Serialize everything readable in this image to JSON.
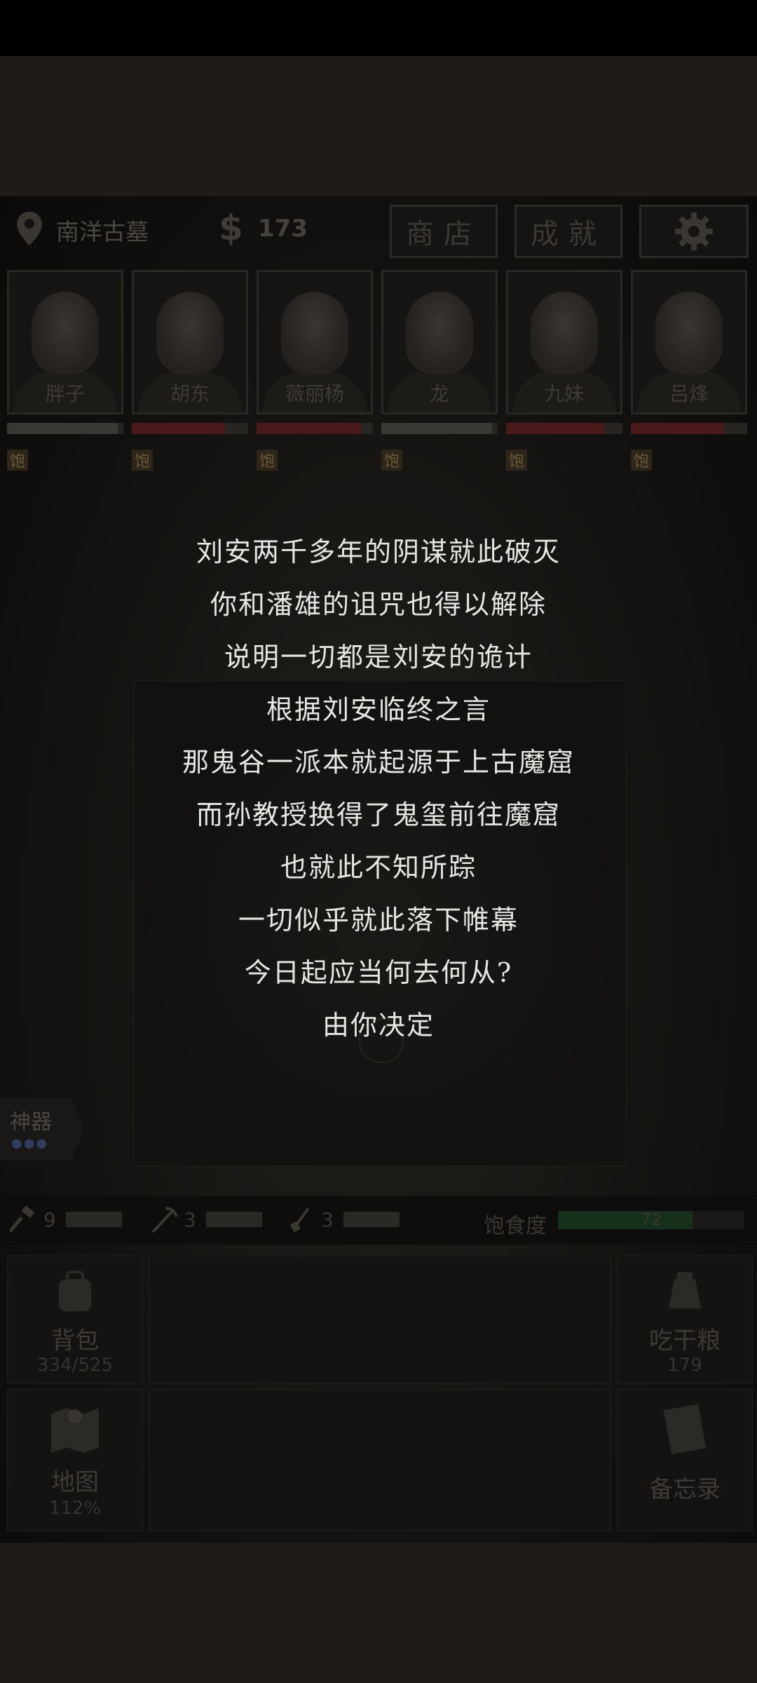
{
  "header": {
    "location": "南洋古墓",
    "money_symbol": "$",
    "money": "173",
    "shop_label": "商店",
    "achievement_label": "成就"
  },
  "characters": [
    {
      "name": "胖子",
      "hp": 0.95,
      "hp_color": "#3a3835",
      "status": "饱"
    },
    {
      "name": "胡东",
      "hp": 0.8,
      "hp_color": "#4a1a1a",
      "status": "饱"
    },
    {
      "name": "薇丽杨",
      "hp": 0.9,
      "hp_color": "#4a1a1a",
      "status": "饱"
    },
    {
      "name": "龙",
      "hp": 0.95,
      "hp_color": "#3a3835",
      "status": "饱"
    },
    {
      "name": "九妹",
      "hp": 0.85,
      "hp_color": "#4a1a1a",
      "status": "饱"
    },
    {
      "name": "吕烽",
      "hp": 0.8,
      "hp_color": "#4a1a1a",
      "status": "饱"
    }
  ],
  "story_lines": [
    "刘安两千多年的阴谋就此破灭",
    "你和潘雄的诅咒也得以解除",
    "说明一切都是刘安的诡计",
    "根据刘安临终之言",
    "那鬼谷一派本就起源于上古魔窟",
    "而孙教授换得了鬼玺前往魔窟",
    "也就此不知所踪",
    "一切似乎就此落下帷幕",
    "今日起应当何去何从?",
    "由你决定"
  ],
  "artifact": {
    "label": "神器",
    "dots": "●●●"
  },
  "tools": [
    {
      "icon": "hammer-icon",
      "count": "9"
    },
    {
      "icon": "pickaxe-icon",
      "count": "3"
    },
    {
      "icon": "shovel-icon",
      "count": "3"
    }
  ],
  "satiety": {
    "label": "饱食度",
    "value": "72",
    "fraction": 0.72
  },
  "tiles": {
    "backpack": {
      "label": "背包",
      "sub": "334/525"
    },
    "eat": {
      "label": "吃干粮",
      "sub": "179"
    },
    "map": {
      "label": "地图",
      "sub": "112%"
    },
    "memo": {
      "label": "备忘录"
    }
  }
}
